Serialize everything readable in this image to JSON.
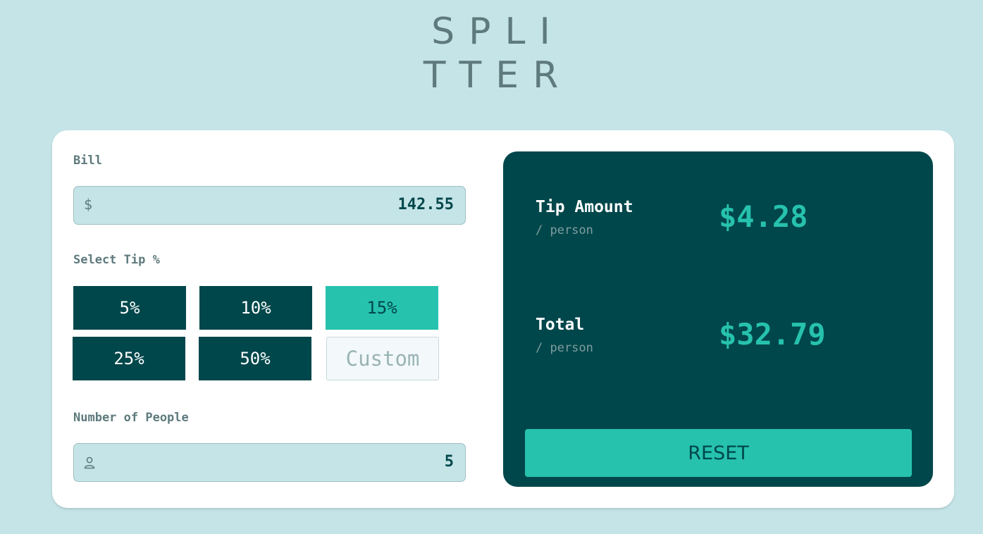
{
  "app": {
    "logo_line1": "SPLI",
    "logo_line2": "TTER"
  },
  "bill": {
    "label": "Bill",
    "currency_symbol": "$",
    "value": "142.55"
  },
  "tip": {
    "label": "Select Tip %",
    "options": [
      "5%",
      "10%",
      "15%",
      "25%",
      "50%"
    ],
    "selected": "15%",
    "custom_placeholder": "Custom"
  },
  "people": {
    "label": "Number of People",
    "value": "5",
    "icon": "person-icon"
  },
  "results": {
    "tip_label": "Tip Amount",
    "tip_sub": "/ person",
    "tip_value": "$4.28",
    "total_label": "Total",
    "total_sub": "/ person",
    "total_value": "$32.79",
    "reset_label": "RESET"
  },
  "colors": {
    "background": "#c5e4e7",
    "dark": "#00474b",
    "accent": "#26c2ad",
    "muted": "#5e7a7d"
  }
}
